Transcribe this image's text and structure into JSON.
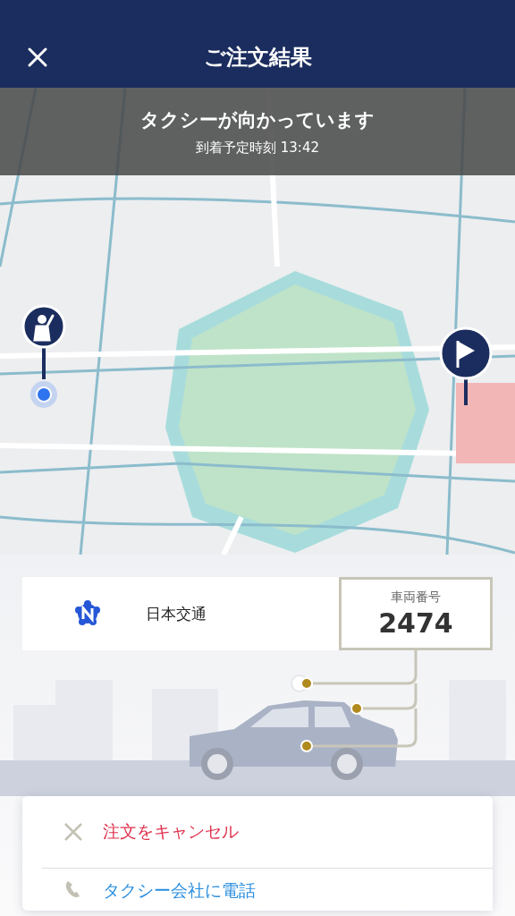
{
  "header": {
    "title": "ご注文結果"
  },
  "status_banner": {
    "title": "タクシーが向かっています",
    "subtitle": "到着予定時刻 13:42"
  },
  "company": {
    "name": "日本交通"
  },
  "vehicle": {
    "label": "車両番号",
    "number": "2474"
  },
  "actions": [
    {
      "kind": "cancel",
      "label": "注文をキャンセル"
    },
    {
      "kind": "call",
      "label": "タクシー会社に電話"
    }
  ]
}
